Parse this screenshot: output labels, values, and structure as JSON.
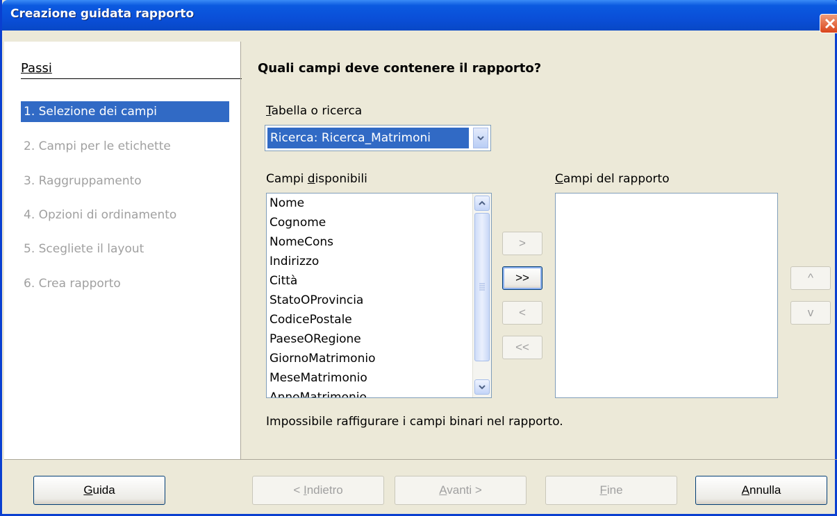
{
  "window": {
    "title": "Creazione guidata rapporto"
  },
  "sidebar": {
    "heading": "Passi",
    "steps": [
      {
        "label": "1. Selezione dei campi",
        "active": true
      },
      {
        "label": "2. Campi per le etichette",
        "active": false
      },
      {
        "label": "3. Raggruppamento",
        "active": false
      },
      {
        "label": "4. Opzioni di ordinamento",
        "active": false
      },
      {
        "label": "5. Scegliete il layout",
        "active": false
      },
      {
        "label": "6. Crea rapporto",
        "active": false
      }
    ]
  },
  "main": {
    "question": "Quali campi deve contenere il rapporto?",
    "table_label_first": "T",
    "table_label_rest": "abella o ricerca",
    "table_value": "Ricerca: Ricerca_Matrimoni",
    "available_label_pre": "Campi ",
    "available_label_u": "d",
    "available_label_post": "isponibili",
    "available_fields": [
      "Nome",
      "Cognome",
      "NomeCons",
      "Indirizzo",
      "Città",
      "StatoOProvincia",
      "CodicePostale",
      "PaeseORegione",
      "GiornoMatrimonio",
      "MeseMatrimonio",
      "AnnoMatrimonio"
    ],
    "report_label_first": "C",
    "report_label_rest": "ampi del rapporto",
    "report_fields": [],
    "move_one": ">",
    "move_all": ">>",
    "remove_one": "<",
    "remove_all": "<<",
    "up": "^",
    "down": "v",
    "note": "Impossibile raffigurare i campi binari nel rapporto."
  },
  "footer": {
    "help_u": "G",
    "help_rest": "uida",
    "back_pre": "< ",
    "back_u": "I",
    "back_rest": "ndietro",
    "next_u": "A",
    "next_rest": "vanti >",
    "finish_u": "F",
    "finish_rest": "ine",
    "cancel_u": "A",
    "cancel_rest": "nnulla"
  }
}
